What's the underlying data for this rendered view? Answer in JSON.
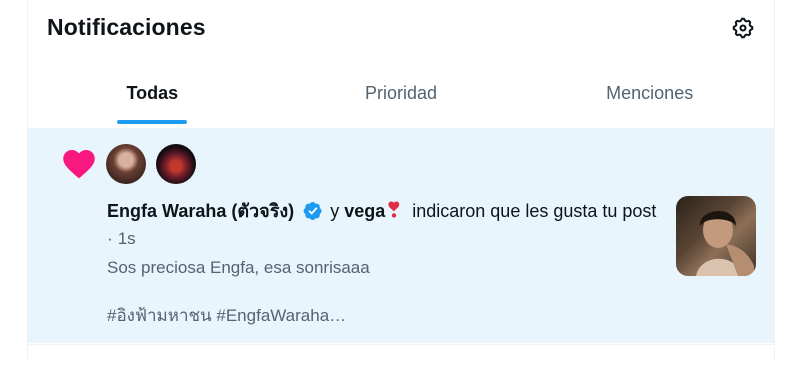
{
  "header": {
    "title": "Notificaciones",
    "settings_icon": "gear-icon"
  },
  "tabs": [
    {
      "label": "Todas",
      "active": true
    },
    {
      "label": "Prioridad",
      "active": false
    },
    {
      "label": "Menciones",
      "active": false
    }
  ],
  "notification": {
    "type_icon": "heart-icon",
    "user1_name": "Engfa Waraha (ตัวจริง)",
    "and_word": "y",
    "user2_name": "vega",
    "action_text": "indicaron que les gusta tu post",
    "separator": "·",
    "time": "1s",
    "snippet": "Sos preciosa Engfa, esa sonrisaaa\n\n#อิงฟ้ามหาชน #EngfaWaraha…"
  },
  "colors": {
    "accent": "#1d9bf0",
    "highlight_bg": "#e8f5fd",
    "heart": "#f91880",
    "muted_text": "#536471"
  }
}
